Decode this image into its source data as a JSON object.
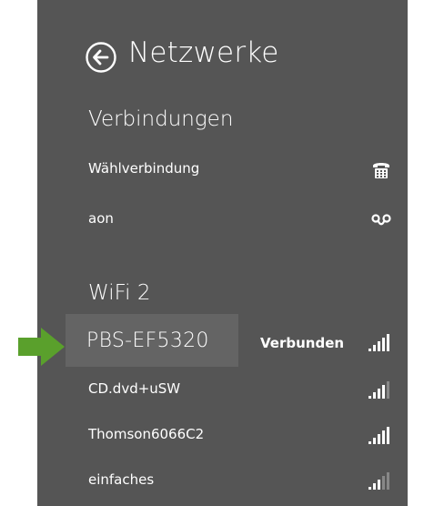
{
  "header": {
    "title": "Netzwerke"
  },
  "sections": {
    "connections": {
      "title": "Verbindungen",
      "items": [
        {
          "label": "Wählverbindung",
          "icon": "dialup-phone-icon"
        },
        {
          "label": "aon",
          "icon": "broadband-link-icon"
        }
      ]
    },
    "wifi": {
      "title": "WiFi 2",
      "selected": {
        "label": "PBS-EF5320",
        "status": "Verbunden",
        "icon": "wifi-signal-icon"
      },
      "items": [
        {
          "label": "CD.dvd+uSW",
          "icon": "wifi-signal-icon"
        },
        {
          "label": "Thomson6066C2",
          "icon": "wifi-signal-icon"
        },
        {
          "label": "einfaches",
          "icon": "wifi-signal-icon"
        }
      ]
    }
  },
  "colors": {
    "panel": "#555555",
    "selected": "#646464",
    "arrow": "#5aa02c",
    "text": "#ffffff"
  }
}
